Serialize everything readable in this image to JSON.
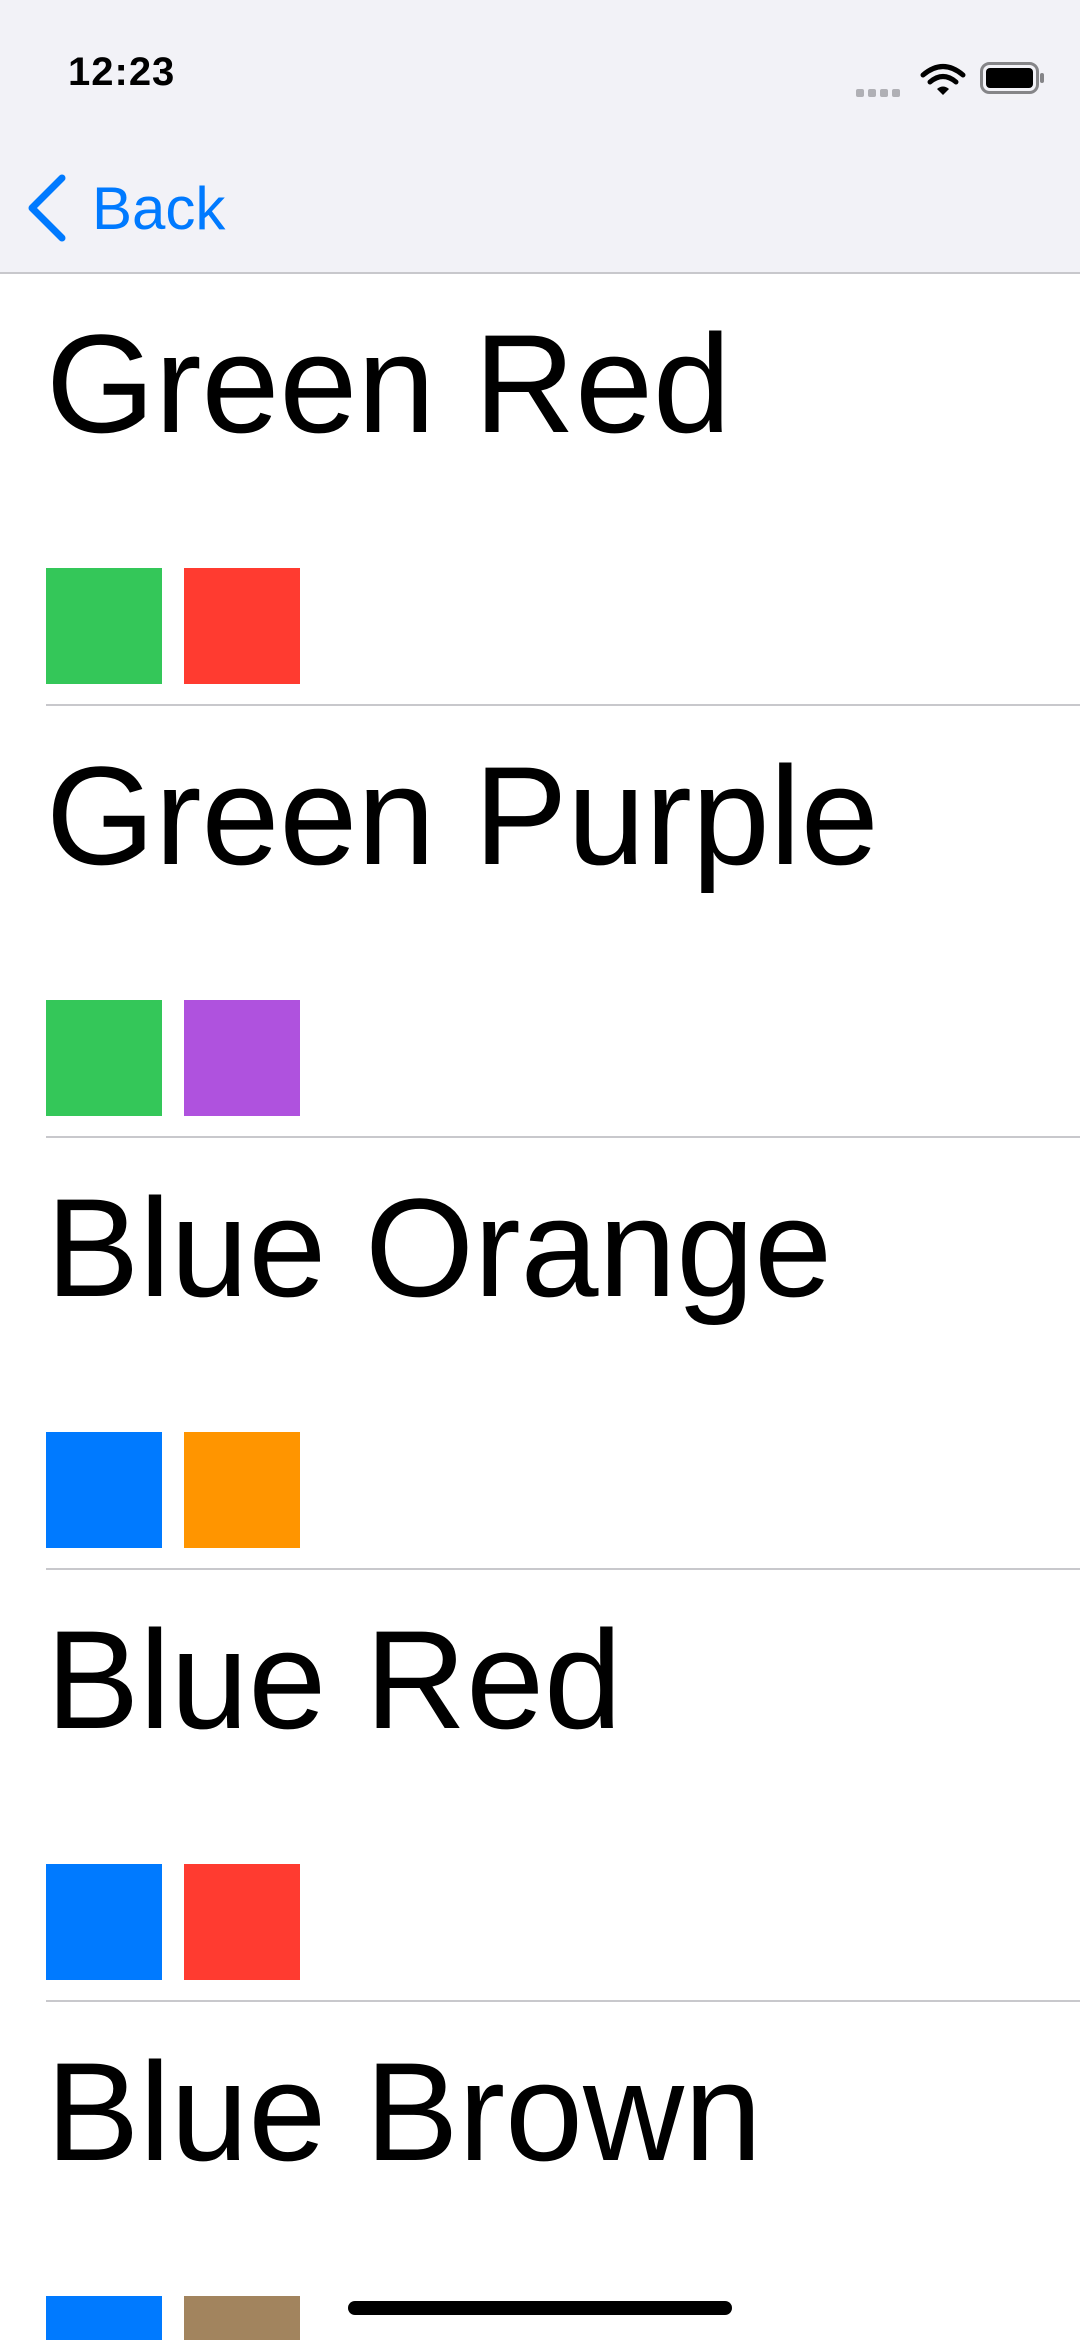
{
  "status_bar": {
    "time": "12:23",
    "icons": [
      "signal-icon",
      "wifi-icon",
      "battery-icon"
    ]
  },
  "nav": {
    "back_label": "Back",
    "back_icon": "chevron-left-icon",
    "accent_color": "#007aff"
  },
  "list": {
    "items": [
      {
        "title": "Green Red",
        "colors": [
          "#34c759",
          "#ff3b30"
        ]
      },
      {
        "title": "Green Purple",
        "colors": [
          "#34c759",
          "#af52de"
        ]
      },
      {
        "title": "Blue Orange",
        "colors": [
          "#007aff",
          "#ff9500"
        ]
      },
      {
        "title": "Blue Red",
        "colors": [
          "#007aff",
          "#ff3b30"
        ]
      },
      {
        "title": "Blue Brown",
        "colors": [
          "#007aff",
          "#a2845e"
        ]
      }
    ]
  }
}
